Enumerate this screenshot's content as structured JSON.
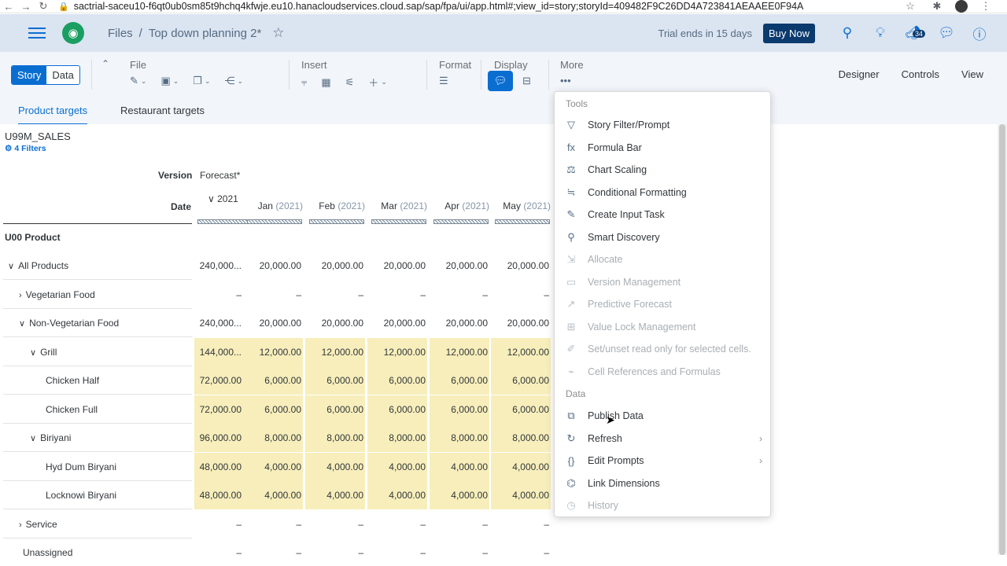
{
  "browser": {
    "url": "sactrial-saceu10-f6qt0ub0sm85t9hchq4kfwje.eu10.hanacloudservices.cloud.sap/sap/fpa/ui/app.html#;view_id=story;storyId=409482F9C26DD4A723841AEAAEE0F94A"
  },
  "shell": {
    "crumb_root": "Files",
    "crumb_sep": "/",
    "crumb_current": "Top down planning 2*",
    "trial": "Trial ends in 15 days",
    "buy": "Buy Now",
    "notif_count": "34"
  },
  "toolbar": {
    "story": "Story",
    "data": "Data",
    "file": "File",
    "insert": "Insert",
    "format": "Format",
    "display": "Display",
    "more": "More",
    "designer": "Designer",
    "controls": "Controls",
    "view": "View"
  },
  "tabs": [
    "Product targets",
    "Restaurant targets"
  ],
  "table": {
    "title": "U99M_SALES",
    "filters": "4 Filters",
    "version_label": "Version",
    "version_value": "Forecast",
    "version_marker": "*",
    "date_label": "Date",
    "dim_label": "U00 Product",
    "year_col": "2021",
    "months": [
      {
        "m": "Jan",
        "y": "(2021)"
      },
      {
        "m": "Feb",
        "y": "(2021)"
      },
      {
        "m": "Mar",
        "y": "(2021)"
      },
      {
        "m": "Apr",
        "y": "(2021)"
      },
      {
        "m": "May",
        "y": "(2021)"
      }
    ],
    "rows": [
      {
        "label": "All Products",
        "chev": "∨",
        "indent": 10,
        "yellow": false,
        "vals": [
          "240,000...",
          "20,000.00",
          "20,000.00",
          "20,000.00",
          "20,000.00",
          "20,000.00"
        ]
      },
      {
        "label": "Vegetarian Food",
        "chev": "›",
        "indent": 24,
        "yellow": false,
        "vals": [
          "–",
          "–",
          "–",
          "–",
          "–",
          "–"
        ]
      },
      {
        "label": "Non-Vegetarian Food",
        "chev": "∨",
        "indent": 24,
        "yellow": false,
        "vals": [
          "240,000...",
          "20,000.00",
          "20,000.00",
          "20,000.00",
          "20,000.00",
          "20,000.00"
        ]
      },
      {
        "label": "Grill",
        "chev": "∨",
        "indent": 38,
        "yellow": true,
        "vals": [
          "144,000...",
          "12,000.00",
          "12,000.00",
          "12,000.00",
          "12,000.00",
          "12,000.00"
        ]
      },
      {
        "label": "Chicken Half",
        "chev": "",
        "indent": 58,
        "yellow": true,
        "vals": [
          "72,000.00",
          "6,000.00",
          "6,000.00",
          "6,000.00",
          "6,000.00",
          "6,000.00"
        ]
      },
      {
        "label": "Chicken Full",
        "chev": "",
        "indent": 58,
        "yellow": true,
        "vals": [
          "72,000.00",
          "6,000.00",
          "6,000.00",
          "6,000.00",
          "6,000.00",
          "6,000.00"
        ]
      },
      {
        "label": "Biriyani",
        "chev": "∨",
        "indent": 38,
        "yellow": true,
        "vals": [
          "96,000.00",
          "8,000.00",
          "8,000.00",
          "8,000.00",
          "8,000.00",
          "8,000.00"
        ]
      },
      {
        "label": "Hyd Dum Biryani",
        "chev": "",
        "indent": 58,
        "yellow": true,
        "vals": [
          "48,000.00",
          "4,000.00",
          "4,000.00",
          "4,000.00",
          "4,000.00",
          "4,000.00"
        ]
      },
      {
        "label": "Locknowi Biryani",
        "chev": "",
        "indent": 58,
        "yellow": true,
        "vals": [
          "48,000.00",
          "4,000.00",
          "4,000.00",
          "4,000.00",
          "4,000.00",
          "4,000.00"
        ]
      },
      {
        "label": "Service",
        "chev": "›",
        "indent": 24,
        "yellow": false,
        "vals": [
          "–",
          "–",
          "–",
          "–",
          "–",
          "–"
        ]
      },
      {
        "label": "Unassigned",
        "chev": "",
        "indent": 29,
        "yellow": false,
        "vals": [
          "–",
          "–",
          "–",
          "–",
          "–",
          "–"
        ]
      }
    ]
  },
  "menu": {
    "tools_header": "Tools",
    "data_header": "Data",
    "tools": [
      {
        "label": "Story Filter/Prompt",
        "icon": "▽",
        "disabled": false
      },
      {
        "label": "Formula Bar",
        "icon": "fx",
        "disabled": false
      },
      {
        "label": "Chart Scaling",
        "icon": "⚖",
        "disabled": false
      },
      {
        "label": "Conditional Formatting",
        "icon": "≒",
        "disabled": false
      },
      {
        "label": "Create Input Task",
        "icon": "✎",
        "disabled": false
      },
      {
        "label": "Smart Discovery",
        "icon": "⚲",
        "disabled": false
      },
      {
        "label": "Allocate",
        "icon": "⇲",
        "disabled": true
      },
      {
        "label": "Version Management",
        "icon": "▭",
        "disabled": true
      },
      {
        "label": "Predictive Forecast",
        "icon": "↗",
        "disabled": true
      },
      {
        "label": "Value Lock Management",
        "icon": "⊞",
        "disabled": true
      },
      {
        "label": "Set/unset read only for selected cells.",
        "icon": "✐",
        "disabled": true
      },
      {
        "label": "Cell References and Formulas",
        "icon": "⌁",
        "disabled": true
      }
    ],
    "data_items": [
      {
        "label": "Publish Data",
        "icon": "⧉",
        "disabled": false,
        "sub": false
      },
      {
        "label": "Refresh",
        "icon": "↻",
        "disabled": false,
        "sub": true
      },
      {
        "label": "Edit Prompts",
        "icon": "{}",
        "disabled": false,
        "sub": true
      },
      {
        "label": "Link Dimensions",
        "icon": "⌬",
        "disabled": false,
        "sub": false
      },
      {
        "label": "History",
        "icon": "◷",
        "disabled": true,
        "sub": false
      }
    ]
  }
}
